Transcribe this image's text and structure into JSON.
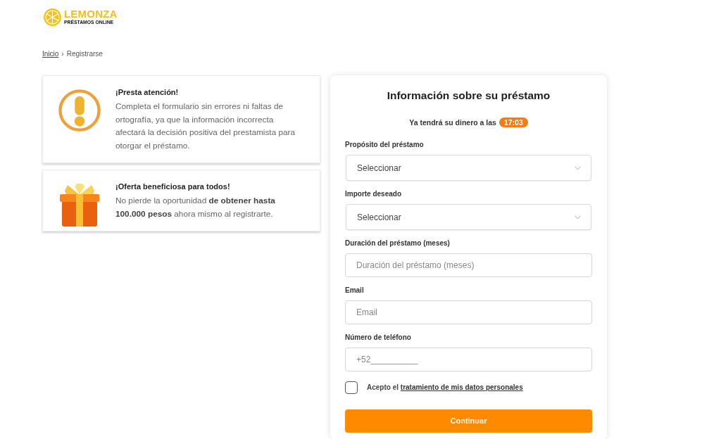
{
  "logo": {
    "wordmark": "LEMONZA",
    "tagline": "PRÉSTAMOS ONLINE"
  },
  "breadcrumb": {
    "separator": "›",
    "items": [
      {
        "label": "Inicio",
        "kind": "link"
      },
      {
        "label": "Registrarse",
        "kind": "current"
      }
    ]
  },
  "notices": [
    {
      "kind": "warning",
      "title": "¡Presta atención!",
      "text": "Completa el formulario sin errores ni faltas de ortografía, ya que la información incorrecta afectará la decisión positiva del prestamista para otorgar el préstamo."
    },
    {
      "kind": "gift",
      "title": "¡Oferta beneficiosa para todos!",
      "text": "No pierde la oportunidad **de obtener hasta 100.000 pesos** ahora mismo al registrarte."
    }
  ],
  "form": {
    "title": "Información sobre su préstamo",
    "eta_text": "Ya tendrá su dinero a las",
    "eta_time": "17:03",
    "fields": [
      {
        "kind": "select",
        "label": "Propósito del préstamo",
        "value": "Seleccionar"
      },
      {
        "kind": "select",
        "label": "Importe deseado",
        "value": "Seleccionar"
      },
      {
        "kind": "text",
        "label": "Duración del préstamo (meses)",
        "placeholder": "Duración del préstamo (meses)"
      },
      {
        "kind": "text",
        "label": "Email",
        "placeholder": "Email"
      },
      {
        "kind": "text",
        "label": "Número de teléfono",
        "placeholder": "+52__________"
      }
    ],
    "consent": {
      "checked": false,
      "text": "Acepto el",
      "link": "tratamiento de mis datos personales"
    },
    "submit": "Continuar"
  }
}
